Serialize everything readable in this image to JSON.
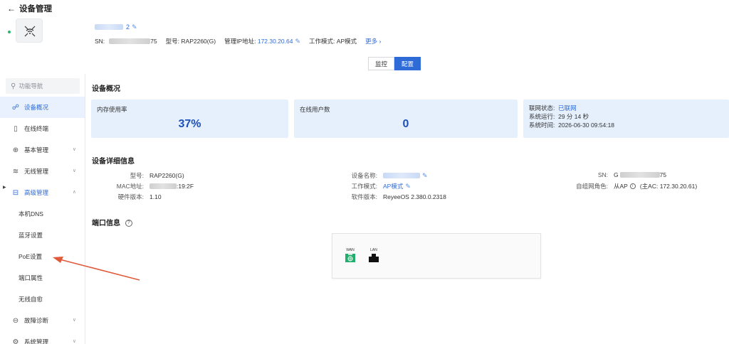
{
  "header": {
    "title": "设备管理",
    "back_icon": "←"
  },
  "device": {
    "name_suffix": "2",
    "sn_label": "SN:",
    "sn_suffix": "75",
    "model_label": "型号:",
    "model": "RAP2260(G)",
    "ip_label": "管理IP地址:",
    "ip": "172.30.20.64",
    "mode_label": "工作模式:",
    "mode": "AP模式",
    "more": "更多",
    "status_color": "#2bb673"
  },
  "tabs": [
    {
      "label": "监控",
      "active": false
    },
    {
      "label": "配置",
      "active": true
    }
  ],
  "sidebar": {
    "search_placeholder": "功能导航",
    "items": [
      {
        "label": "设备概况",
        "icon": "topology-icon",
        "active": true
      },
      {
        "label": "在线终端",
        "icon": "device-icon"
      },
      {
        "label": "基本管理",
        "icon": "globe-icon",
        "chev": "∨"
      },
      {
        "label": "无线管理",
        "icon": "wifi-icon",
        "chev": "∨"
      },
      {
        "label": "高级管理",
        "icon": "briefcase-icon",
        "chev": "∧"
      },
      {
        "label": "本机DNS"
      },
      {
        "label": "蓝牙设置"
      },
      {
        "label": "PoE设置"
      },
      {
        "label": "端口属性"
      },
      {
        "label": "无线自愈"
      },
      {
        "label": "故障诊断",
        "icon": "diagnose-icon",
        "chev": "∨"
      },
      {
        "label": "系统管理",
        "icon": "settings-icon",
        "chev": "∨"
      }
    ]
  },
  "overview": {
    "title": "设备概况",
    "memory_label": "内存使用率",
    "memory_value": "37%",
    "users_label": "在线用户数",
    "users_value": "0",
    "net_status_label": "联网状态:",
    "net_status": "已联网",
    "uptime_label": "系统运行:",
    "uptime": "29 分 14 秒",
    "systime_label": "系统时间:",
    "systime": "2026-06-30 09:54:18"
  },
  "detail": {
    "title": "设备详细信息",
    "model_label": "型号:",
    "model": "RAP2260(G)",
    "mac_label": "MAC地址:",
    "mac_suffix": ":19:2F",
    "hw_label": "硬件版本:",
    "hw": "1.10",
    "devname_label": "设备名称:",
    "workmode_label": "工作模式:",
    "workmode": "AP模式",
    "sw_label": "软件版本:",
    "sw": "ReyeeOS 2.380.0.2318",
    "sn_label": "SN:",
    "sn_prefix": "G",
    "sn_suffix": "75",
    "role_label": "自组网角色:",
    "role": "从AP",
    "role_info": "(主AC: 172.30.20.61)"
  },
  "ports": {
    "title": "端口信息",
    "help": "?",
    "wan_label": "WAN",
    "lan_label": "LAN",
    "wan_color": "#1fae6b",
    "lan_color": "#111111"
  },
  "annotation": {
    "arrow_color": "#e05a3a"
  }
}
